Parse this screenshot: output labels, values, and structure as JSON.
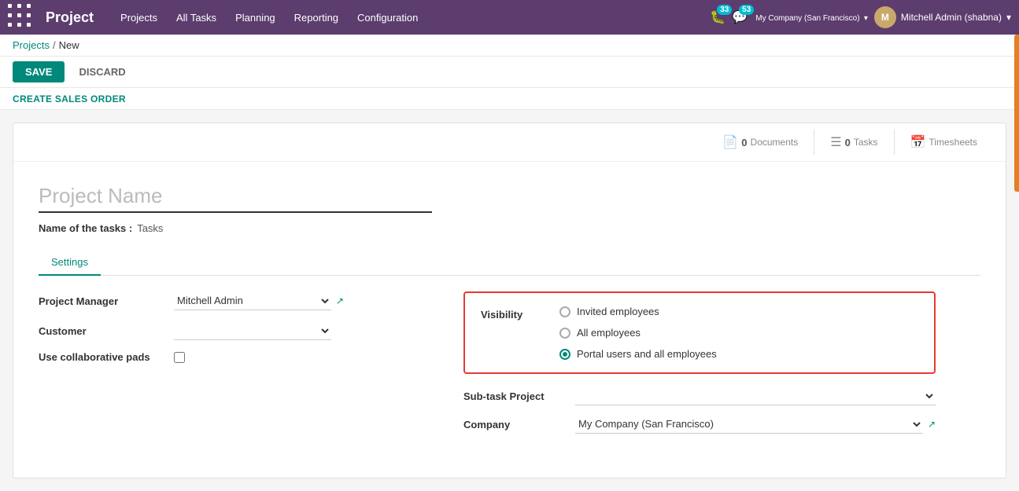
{
  "navbar": {
    "brand": "Project",
    "menu_items": [
      "Projects",
      "All Tasks",
      "Planning",
      "Reporting",
      "Configuration"
    ],
    "badge_bug": "33",
    "badge_msg": "53",
    "company": "My Company (San Francisco)",
    "user": "Mitchell Admin (shabna)"
  },
  "breadcrumb": {
    "link": "Projects",
    "separator": "/",
    "current": "New"
  },
  "actions": {
    "save": "SAVE",
    "discard": "DISCARD",
    "create_sales_order": "CREATE SALES ORDER"
  },
  "card_buttons": {
    "documents_count": "0",
    "documents_label": "Documents",
    "tasks_count": "0",
    "tasks_label": "Tasks",
    "timesheets_label": "Timesheets"
  },
  "form": {
    "project_name_placeholder": "Project Name",
    "name_of_tasks_label": "Name of the tasks :",
    "name_of_tasks_value": "Tasks"
  },
  "tabs": [
    {
      "id": "settings",
      "label": "Settings"
    }
  ],
  "left_fields": {
    "project_manager_label": "Project Manager",
    "project_manager_value": "Mitchell Admin",
    "customer_label": "Customer",
    "customer_value": "",
    "collab_pads_label": "Use collaborative pads"
  },
  "visibility": {
    "label": "Visibility",
    "options": [
      {
        "id": "invited",
        "label": "Invited employees",
        "checked": false
      },
      {
        "id": "all",
        "label": "All employees",
        "checked": false
      },
      {
        "id": "portal",
        "label": "Portal users and all employees",
        "checked": true
      }
    ]
  },
  "right_fields": {
    "subtask_project_label": "Sub-task Project",
    "subtask_project_value": "",
    "company_label": "Company",
    "company_value": "My Company (San Francisco)"
  }
}
